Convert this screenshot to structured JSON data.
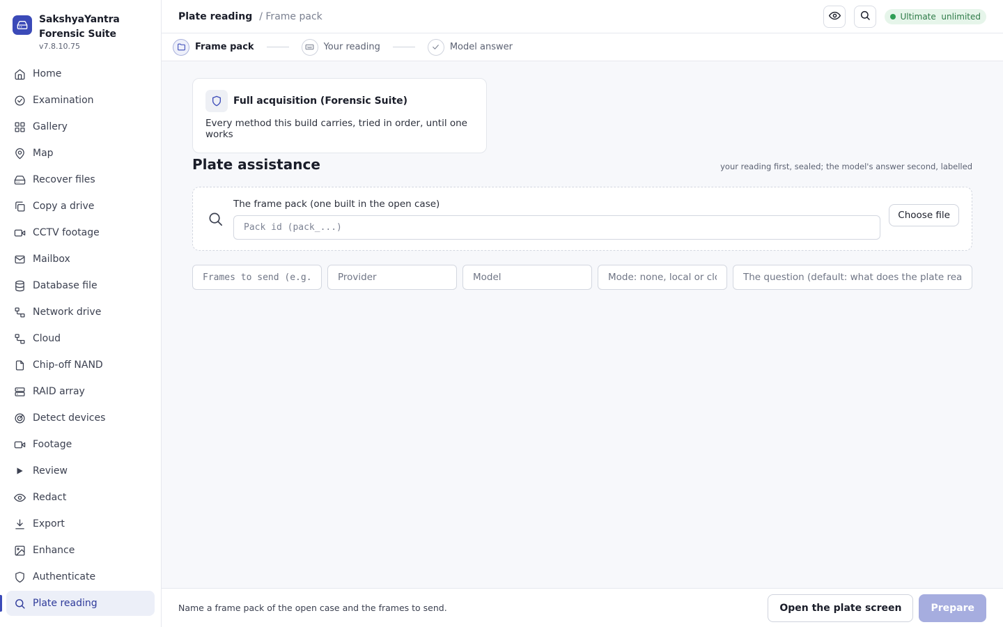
{
  "brand": {
    "name": "SakshyaYantra Forensic Suite",
    "version": "v7.8.10.75",
    "accent": "#3b4ab8"
  },
  "sidebar": {
    "items": [
      {
        "label": "Home",
        "icon": "home-icon"
      },
      {
        "label": "Examination",
        "icon": "check-circle-icon"
      },
      {
        "label": "Gallery",
        "icon": "grid-icon"
      },
      {
        "label": "Map",
        "icon": "map-pin-icon"
      },
      {
        "label": "Recover files",
        "icon": "hard-drive-icon"
      },
      {
        "label": "Copy a drive",
        "icon": "copy-icon"
      },
      {
        "label": "CCTV footage",
        "icon": "video-icon"
      },
      {
        "label": "Mailbox",
        "icon": "mail-icon"
      },
      {
        "label": "Database file",
        "icon": "database-icon"
      },
      {
        "label": "Network drive",
        "icon": "network-icon"
      },
      {
        "label": "Cloud",
        "icon": "network-icon"
      },
      {
        "label": "Chip-off NAND",
        "icon": "file-icon"
      },
      {
        "label": "RAID array",
        "icon": "server-icon"
      },
      {
        "label": "Detect devices",
        "icon": "radar-icon"
      },
      {
        "label": "Footage",
        "icon": "video-icon"
      },
      {
        "label": "Review",
        "icon": "play-icon"
      },
      {
        "label": "Redact",
        "icon": "eye-icon"
      },
      {
        "label": "Export",
        "icon": "download-icon"
      },
      {
        "label": "Enhance",
        "icon": "image-icon"
      },
      {
        "label": "Authenticate",
        "icon": "shield-icon"
      },
      {
        "label": "Plate reading",
        "icon": "search-icon",
        "active": true
      }
    ]
  },
  "header": {
    "title": "Plate reading",
    "crumb": "/ Frame pack",
    "badge": "Ultimate  unlimited"
  },
  "steps": [
    {
      "label": "Frame pack",
      "icon": "folder-icon",
      "current": true
    },
    {
      "label": "Your reading",
      "icon": "keyboard-icon"
    },
    {
      "label": "Model answer",
      "icon": "check-icon"
    }
  ],
  "method": {
    "title": "Full acquisition (Forensic Suite)",
    "description": "Every method this build carries, tried in order, until one works"
  },
  "section": {
    "title": "Plate assistance",
    "note": "your reading first, sealed; the model's answer second, labelled"
  },
  "pack": {
    "label": "The frame pack (one built in the open case)",
    "placeholder": "Pack id (pack_...)",
    "choose_label": "Choose file"
  },
  "fields": {
    "frames_placeholder": "Frames to send (e.g.",
    "provider_placeholder": "Provider",
    "model_placeholder": "Model",
    "mode_placeholder": "Mode: none, local or clou",
    "question_placeholder": "The question (default: what does the plate read)"
  },
  "footer": {
    "message": "Name a frame pack of the open case and the frames to send.",
    "secondary_label": "Open the plate screen",
    "primary_label": "Prepare"
  }
}
